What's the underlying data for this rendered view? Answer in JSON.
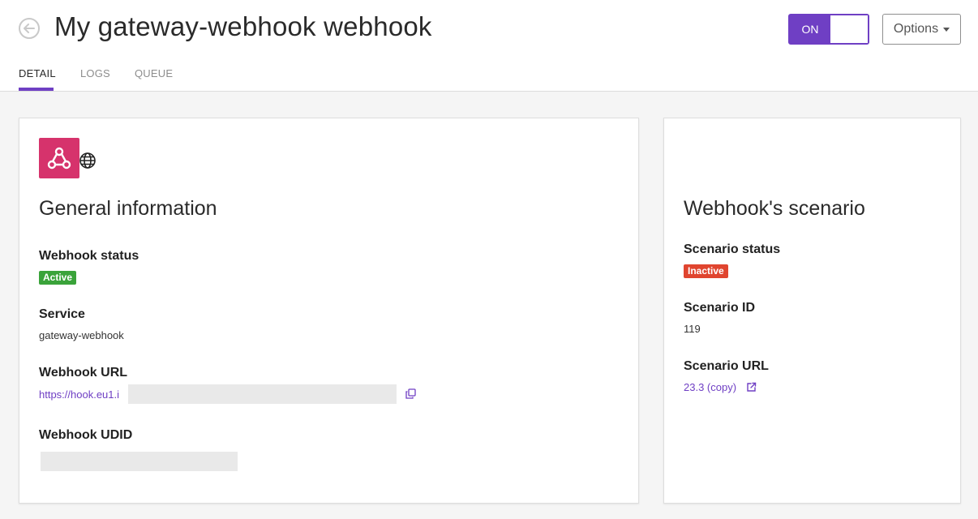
{
  "header": {
    "title": "My gateway-webhook webhook",
    "toggle_label": "ON",
    "options_label": "Options"
  },
  "tabs": [
    {
      "label": "DETAIL"
    },
    {
      "label": "LOGS"
    },
    {
      "label": "QUEUE"
    }
  ],
  "general": {
    "heading": "General information",
    "status_label": "Webhook status",
    "status_value": "Active",
    "service_label": "Service",
    "service_value": "gateway-webhook",
    "url_label": "Webhook URL",
    "url_value": "https://hook.eu1.i",
    "udid_label": "Webhook UDID"
  },
  "scenario": {
    "heading": "Webhook's scenario",
    "status_label": "Scenario status",
    "status_value": "Inactive",
    "id_label": "Scenario ID",
    "id_value": "119",
    "url_label": "Scenario URL",
    "url_value": "23.3 (copy)"
  },
  "colors": {
    "accent": "#6f3fc4",
    "active": "#3aa33a",
    "inactive": "#e0452f",
    "app_icon": "#d6336c"
  },
  "icons": [
    "back-arrow-icon",
    "webhook-icon",
    "globe-icon",
    "copy-icon",
    "external-link-icon",
    "caret-down-icon"
  ]
}
